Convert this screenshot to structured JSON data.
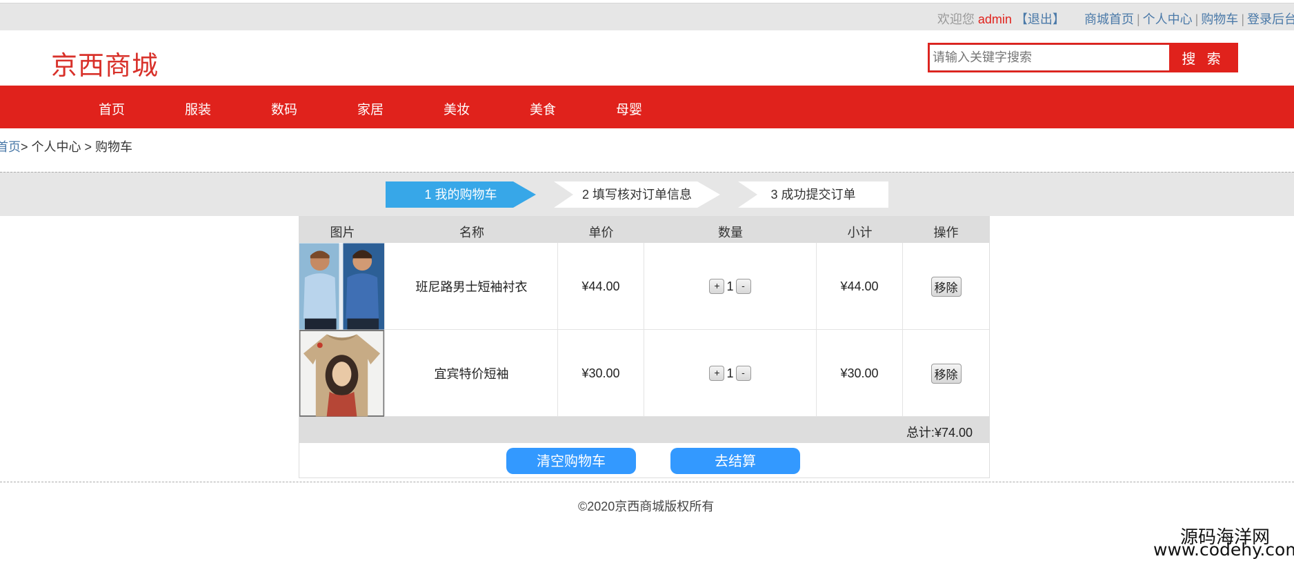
{
  "topbar": {
    "welcome": "欢迎您",
    "username": "admin",
    "logout": "【退出】",
    "links": [
      "商城首页",
      "个人中心",
      "购物车",
      "登录后台"
    ],
    "separator": "|"
  },
  "header": {
    "logo": "京西商城",
    "search_placeholder": "请输入关键字搜索",
    "search_button": "搜 索"
  },
  "nav": [
    "首页",
    "服装",
    "数码",
    "家居",
    "美妆",
    "美食",
    "母婴"
  ],
  "breadcrumb": {
    "home": "首页",
    "rest": "> 个人中心 > 购物车"
  },
  "steps": [
    "1 我的购物车",
    "2 填写核对订单信息",
    "3 成功提交订单"
  ],
  "cart": {
    "headers": [
      "图片",
      "名称",
      "单价",
      "数量",
      "小计",
      "操作"
    ],
    "items": [
      {
        "name": "班尼路男士短袖衬衣",
        "price": "¥44.00",
        "qty": "1",
        "subtotal": "¥44.00",
        "remove": "移除",
        "plus": "+",
        "minus": "-"
      },
      {
        "name": "宜宾特价短袖",
        "price": "¥30.00",
        "qty": "1",
        "subtotal": "¥30.00",
        "remove": "移除",
        "plus": "+",
        "minus": "-"
      }
    ],
    "total": "总计:¥74.00",
    "clear_button": "清空购物车",
    "checkout_button": "去结算"
  },
  "footer": "©2020京西商城版权所有",
  "watermark": {
    "line1": "源码海洋网",
    "line2": "www.codehy.com"
  },
  "colors": {
    "brand_red": "#e0221c",
    "step_active": "#37a7e8",
    "action_blue": "#3399ff"
  }
}
